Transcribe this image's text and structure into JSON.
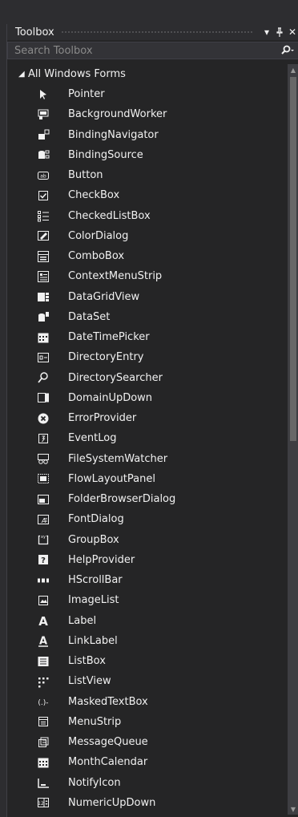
{
  "toolbox": {
    "title": "Toolbox",
    "dropdown_icon": "▾",
    "pin_icon": "⮍",
    "close_icon": "✕",
    "search_placeholder": "Search Toolbox"
  },
  "group": {
    "label": "All Windows Forms",
    "expanded_icon": "◢"
  },
  "items": [
    {
      "label": "Pointer",
      "icon": "pointer-icon"
    },
    {
      "label": "BackgroundWorker",
      "icon": "background-worker-icon"
    },
    {
      "label": "BindingNavigator",
      "icon": "binding-navigator-icon"
    },
    {
      "label": "BindingSource",
      "icon": "binding-source-icon"
    },
    {
      "label": "Button",
      "icon": "button-icon"
    },
    {
      "label": "CheckBox",
      "icon": "checkbox-icon"
    },
    {
      "label": "CheckedListBox",
      "icon": "checked-list-box-icon"
    },
    {
      "label": "ColorDialog",
      "icon": "color-dialog-icon"
    },
    {
      "label": "ComboBox",
      "icon": "combobox-icon"
    },
    {
      "label": "ContextMenuStrip",
      "icon": "context-menu-strip-icon"
    },
    {
      "label": "DataGridView",
      "icon": "data-grid-view-icon"
    },
    {
      "label": "DataSet",
      "icon": "dataset-icon"
    },
    {
      "label": "DateTimePicker",
      "icon": "date-time-picker-icon"
    },
    {
      "label": "DirectoryEntry",
      "icon": "directory-entry-icon"
    },
    {
      "label": "DirectorySearcher",
      "icon": "directory-searcher-icon"
    },
    {
      "label": "DomainUpDown",
      "icon": "domain-up-down-icon"
    },
    {
      "label": "ErrorProvider",
      "icon": "error-provider-icon"
    },
    {
      "label": "EventLog",
      "icon": "event-log-icon"
    },
    {
      "label": "FileSystemWatcher",
      "icon": "file-system-watcher-icon"
    },
    {
      "label": "FlowLayoutPanel",
      "icon": "flow-layout-panel-icon"
    },
    {
      "label": "FolderBrowserDialog",
      "icon": "folder-browser-dialog-icon"
    },
    {
      "label": "FontDialog",
      "icon": "font-dialog-icon"
    },
    {
      "label": "GroupBox",
      "icon": "group-box-icon"
    },
    {
      "label": "HelpProvider",
      "icon": "help-provider-icon"
    },
    {
      "label": "HScrollBar",
      "icon": "hscrollbar-icon"
    },
    {
      "label": "ImageList",
      "icon": "image-list-icon"
    },
    {
      "label": "Label",
      "icon": "label-icon"
    },
    {
      "label": "LinkLabel",
      "icon": "link-label-icon"
    },
    {
      "label": "ListBox",
      "icon": "list-box-icon"
    },
    {
      "label": "ListView",
      "icon": "list-view-icon"
    },
    {
      "label": "MaskedTextBox",
      "icon": "masked-text-box-icon"
    },
    {
      "label": "MenuStrip",
      "icon": "menu-strip-icon"
    },
    {
      "label": "MessageQueue",
      "icon": "message-queue-icon"
    },
    {
      "label": "MonthCalendar",
      "icon": "month-calendar-icon"
    },
    {
      "label": "NotifyIcon",
      "icon": "notify-icon-icon"
    },
    {
      "label": "NumericUpDown",
      "icon": "numeric-up-down-icon"
    }
  ],
  "colors": {
    "background": "#252526",
    "text": "#f1f1f1",
    "scrollbar_track": "#3e3e42",
    "scrollbar_thumb": "#686868"
  }
}
